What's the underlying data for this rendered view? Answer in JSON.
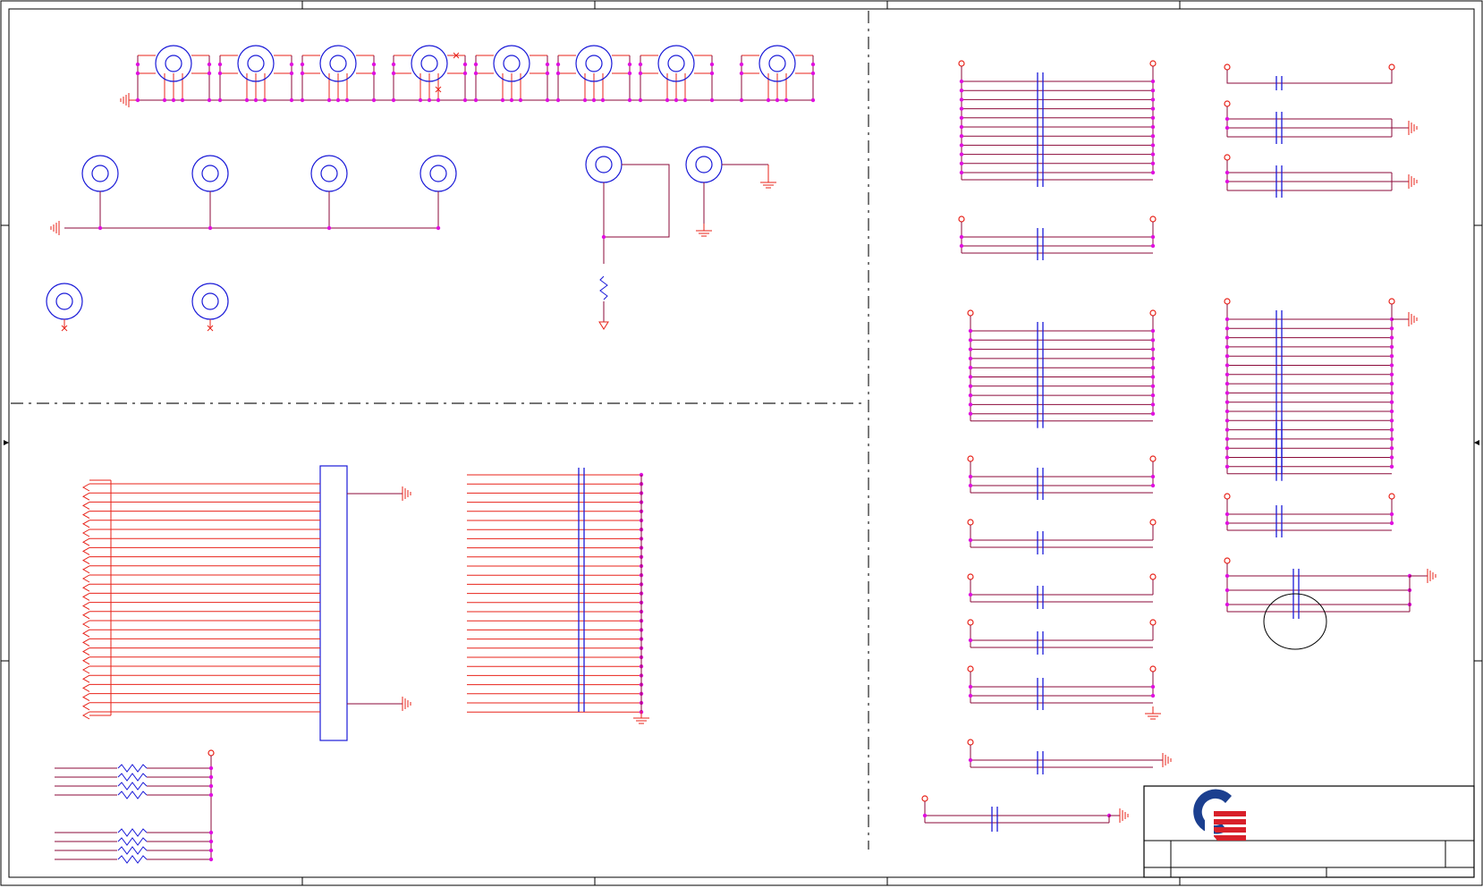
{
  "colors": {
    "frame": "#000000",
    "wire": "#8b0a3a",
    "pin_red": "#e8231a",
    "component_blue": "#1a1ad8",
    "junction": "#e010e0",
    "logo_blue": "#1b3f8f",
    "logo_red": "#d8202a"
  },
  "icons": {
    "mounting_hole": "ring-icon",
    "ground": "ground-icon",
    "chassis_ground": "chassis-ground-icon",
    "capacitor": "capacitor-icon",
    "resistor": "resistor-icon",
    "no_connect": "no-connect-x-icon",
    "power_port": "power-circle-icon",
    "logo": "company-logo-icon"
  },
  "title_block": {
    "logo": "company-logo-icon",
    "title": "",
    "sheet": ""
  }
}
